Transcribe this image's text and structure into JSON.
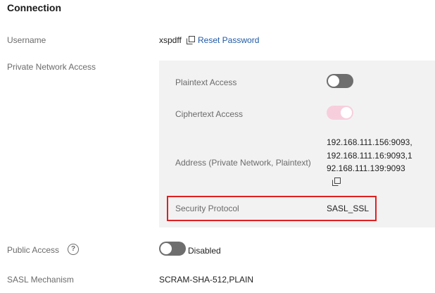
{
  "section_title": "Connection",
  "username": {
    "label": "Username",
    "value": "xspdff",
    "reset_label": "Reset Password"
  },
  "private_network": {
    "label": "Private Network Access",
    "plaintext_label": "Plaintext Access",
    "plaintext_enabled": false,
    "ciphertext_label": "Ciphertext Access",
    "ciphertext_enabled": true,
    "address_label": "Address (Private Network, Plaintext)",
    "address_lines": [
      "192.168.111.156:9093,",
      "192.168.111.16:9093,1",
      "92.168.111.139:9093"
    ],
    "security_label": "Security Protocol",
    "security_value": "SASL_SSL"
  },
  "public_access": {
    "label": "Public Access",
    "help_glyph": "?",
    "status": "Disabled",
    "enabled": false
  },
  "sasl": {
    "label": "SASL Mechanism",
    "value": "SCRAM-SHA-512,PLAIN"
  },
  "colors": {
    "highlight_border": "#e02020",
    "link": "#1f5aa6",
    "toggle_off": "#6e6e6e",
    "toggle_on_disabled": "#f7cfdc",
    "panel_bg": "#f2f2f3"
  }
}
